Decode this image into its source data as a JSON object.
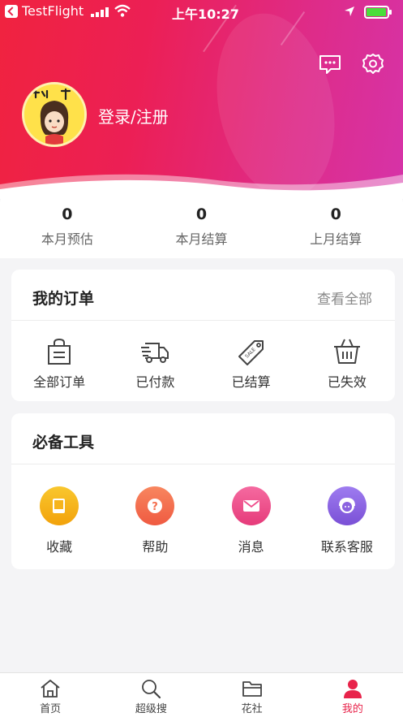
{
  "status_bar": {
    "carrier": "TestFlight",
    "time": "上午10:27"
  },
  "header": {
    "login_text": "登录/注册",
    "colors": {
      "gradient_start": "#f0233f",
      "gradient_end": "#d633a8"
    }
  },
  "stats": [
    {
      "value": "0",
      "label": "本月预估"
    },
    {
      "value": "0",
      "label": "本月结算"
    },
    {
      "value": "0",
      "label": "上月结算"
    }
  ],
  "orders": {
    "title": "我的订单",
    "view_all": "查看全部",
    "items": [
      {
        "label": "全部订单",
        "icon": "shopping-bag-icon"
      },
      {
        "label": "已付款",
        "icon": "delivery-truck-icon"
      },
      {
        "label": "已结算",
        "icon": "sale-tag-icon"
      },
      {
        "label": "已失效",
        "icon": "basket-icon"
      }
    ]
  },
  "tools": {
    "title": "必备工具",
    "items": [
      {
        "label": "收藏",
        "icon": "book-icon",
        "color": "#f6b41c"
      },
      {
        "label": "帮助",
        "icon": "question-icon",
        "color": "#f46f4f"
      },
      {
        "label": "消息",
        "icon": "envelope-icon",
        "color": "#ef4c8b"
      },
      {
        "label": "联系客服",
        "icon": "service-agent-icon",
        "color": "#8b63e0"
      }
    ]
  },
  "tabbar": {
    "active_color": "#e8234a",
    "items": [
      {
        "label": "首页",
        "icon": "home-icon"
      },
      {
        "label": "超级搜",
        "icon": "search-icon"
      },
      {
        "label": "花社",
        "icon": "folder-icon"
      },
      {
        "label": "我的",
        "icon": "user-icon",
        "active": true
      }
    ]
  }
}
